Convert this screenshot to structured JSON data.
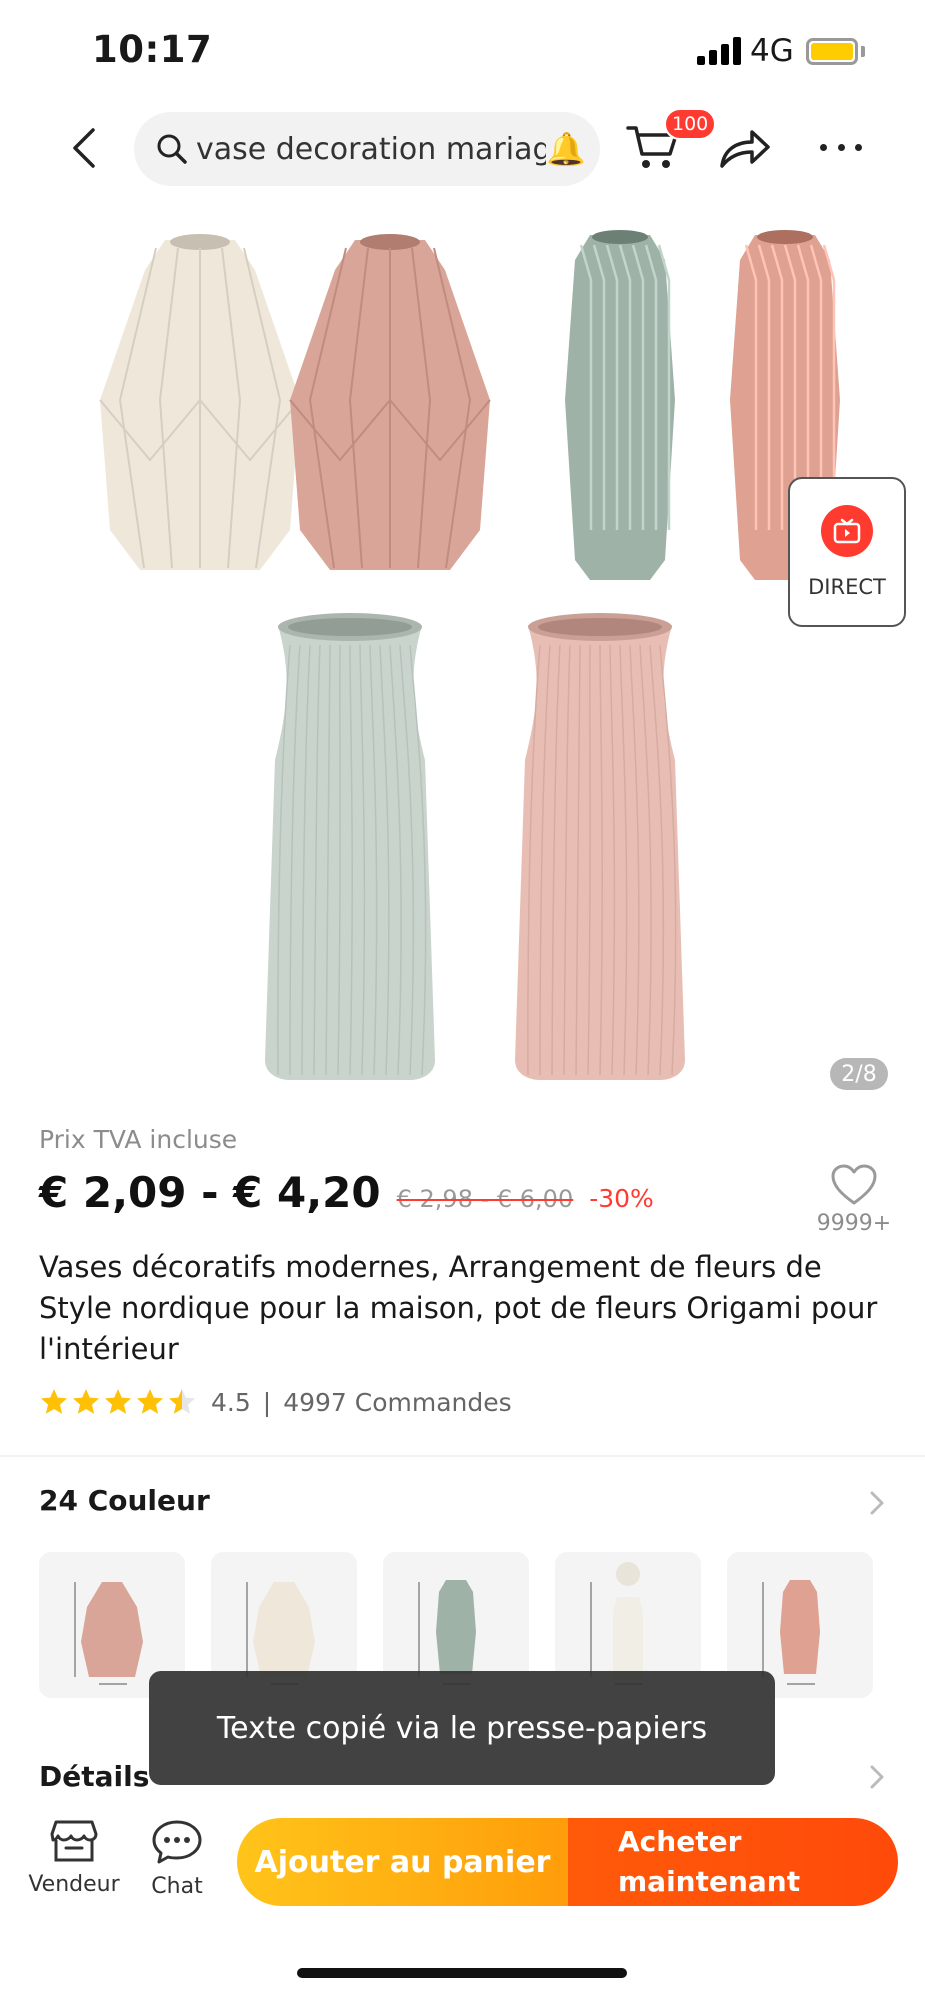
{
  "status_bar": {
    "time": "10:17",
    "network": "4G",
    "battery_color": "#ffcc00"
  },
  "header": {
    "search_query": "vase decoration mariage",
    "cart_count": "100",
    "icons": [
      "back-icon",
      "search-icon",
      "bell-icon",
      "cart-icon",
      "share-icon",
      "more-icon"
    ]
  },
  "gallery": {
    "direct_label": "DIRECT",
    "page_indicator": "2/8",
    "vase_colors": [
      "#efe8da",
      "#d9a598",
      "#9fb2a7",
      "#dea192",
      "#c8d4cc",
      "#e8beb4"
    ]
  },
  "product": {
    "tax_note": "Prix TVA incluse",
    "price": "€ 2,09 - € 4,20",
    "original_price": "€ 2,98 - € 6,00",
    "discount": "-30%",
    "wishlist_count": "9999+",
    "title": "Vases décoratifs modernes, Arrangement de fleurs de Style nordique pour la maison, pot de fleurs Origami pour l'intérieur",
    "rating": "4.5",
    "rating_separator": "|",
    "orders": "4997 Commandes"
  },
  "colors": {
    "title": "24 Couleur",
    "swatches": [
      {
        "color": "#d9a598"
      },
      {
        "color": "#efe8da"
      },
      {
        "color": "#9fb2a7"
      },
      {
        "color": "#f1eee6"
      },
      {
        "color": "#dea192"
      }
    ]
  },
  "details": {
    "title": "Détails"
  },
  "toast": {
    "message": "Texte copié via le presse-papiers"
  },
  "bottom_bar": {
    "store_label": "Vendeur",
    "chat_label": "Chat",
    "add_to_cart": "Ajouter au panier",
    "buy_now": "Acheter maintenant",
    "accent_colors": [
      "#ffc41a",
      "#ff5a0a"
    ]
  }
}
